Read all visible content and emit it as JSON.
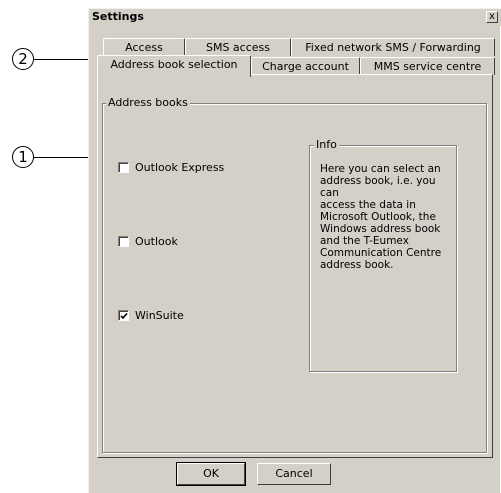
{
  "callouts": {
    "one": "1",
    "two": "2"
  },
  "window": {
    "title": "Settings",
    "close_glyph": "x"
  },
  "tabs": {
    "back_row": [
      "Access",
      "SMS access",
      "Fixed network SMS / Forwarding"
    ],
    "front_row": [
      "Address book selection",
      "Charge account",
      "MMS service centre"
    ],
    "active": "Address book selection"
  },
  "address_books": {
    "group_label": "Address books",
    "options": [
      {
        "label": "Outlook Express",
        "checked": false
      },
      {
        "label": "Outlook",
        "checked": false
      },
      {
        "label": "WinSuite",
        "checked": true
      }
    ]
  },
  "info": {
    "group_label": "Info",
    "lines": [
      "Here you can select an",
      "address book, i.e. you can",
      "access the data in",
      "Microsoft Outlook, the",
      "Windows address book",
      "and the T-Eumex",
      "Communication Centre",
      "address book."
    ]
  },
  "buttons": {
    "ok": "OK",
    "cancel": "Cancel"
  }
}
